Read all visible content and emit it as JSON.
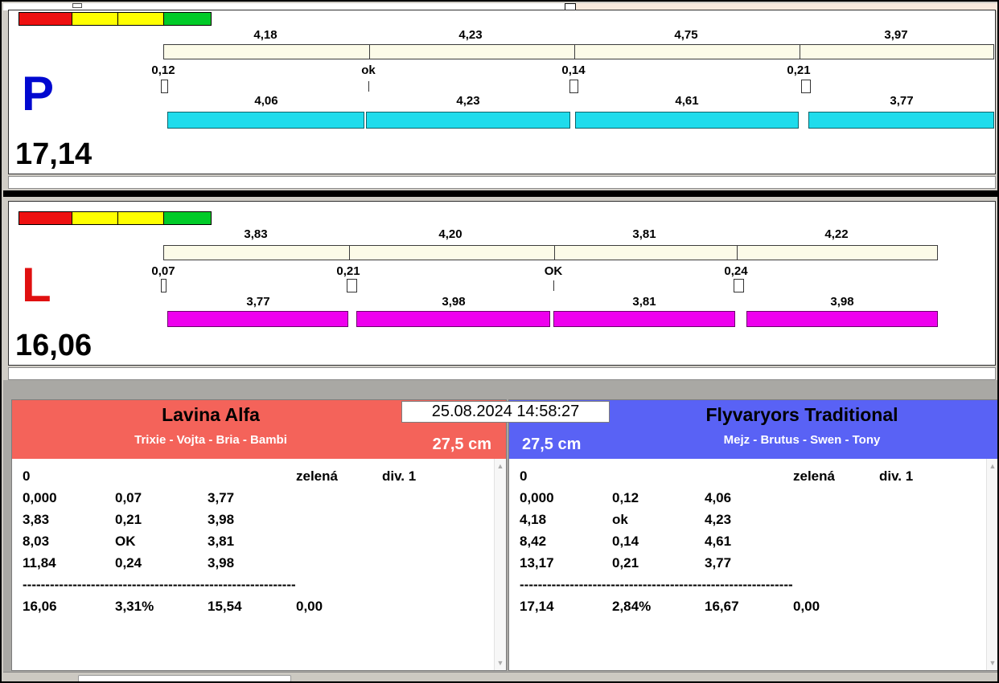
{
  "timestamp": "25.08.2024 14:58:27",
  "lane_p": {
    "letter": "P",
    "letter_color": "#0008d0",
    "total_time": "17,14",
    "lights": [
      "#ee1111",
      "#ffff00",
      "#ffff00",
      "#00cb28"
    ],
    "top_bar_color": "#fcfbe8",
    "bottom_bar_color": "#1fdcec",
    "splits_top": [
      "4,18",
      "4,23",
      "4,75",
      "3,97"
    ],
    "cross_marks": [
      "0,12",
      "ok",
      "0,14",
      "0,21"
    ],
    "splits_bottom": [
      "4,06",
      "4,23",
      "4,61",
      "3,77"
    ]
  },
  "lane_l": {
    "letter": "L",
    "letter_color": "#e01010",
    "total_time": "16,06",
    "lights": [
      "#ee1111",
      "#ffff00",
      "#ffff00",
      "#00cb28"
    ],
    "top_bar_color": "#fcfbe8",
    "bottom_bar_color": "#ee00ee",
    "splits_top": [
      "3,83",
      "4,20",
      "3,81",
      "4,22"
    ],
    "cross_marks": [
      "0,07",
      "0,21",
      "OK",
      "0,24"
    ],
    "splits_bottom": [
      "3,77",
      "3,98",
      "3,81",
      "3,98"
    ]
  },
  "team_left": {
    "name": "Lavina Alfa",
    "lineup": "Trixie - Vojta - Bria - Bambi",
    "jump_height": "27,5 cm",
    "header_color": "#f4635a",
    "status": {
      "flag": "0",
      "light": "zelená",
      "division": "div. 1"
    },
    "runs": [
      [
        "0,000",
        "0,07",
        "3,77"
      ],
      [
        "3,83",
        "0,21",
        "3,98"
      ],
      [
        "8,03",
        "OK",
        "3,81"
      ],
      [
        "11,84",
        "0,24",
        "3,98"
      ]
    ],
    "separator": "------------------------------------------------------------",
    "summary": [
      "16,06",
      "3,31%",
      "15,54",
      "0,00"
    ]
  },
  "team_right": {
    "name": "Flyvaryors Traditional",
    "lineup": "Mejz - Brutus - Swen - Tony",
    "jump_height": "27,5 cm",
    "header_color": "#5962f5",
    "status": {
      "flag": "0",
      "light": "zelená",
      "division": "div. 1"
    },
    "runs": [
      [
        "0,000",
        "0,12",
        "4,06"
      ],
      [
        "4,18",
        "ok",
        "4,23"
      ],
      [
        "8,42",
        "0,14",
        "4,61"
      ],
      [
        "13,17",
        "0,21",
        "3,77"
      ]
    ],
    "separator": "------------------------------------------------------------",
    "summary": [
      "17,14",
      "2,84%",
      "16,67",
      "0,00"
    ]
  }
}
